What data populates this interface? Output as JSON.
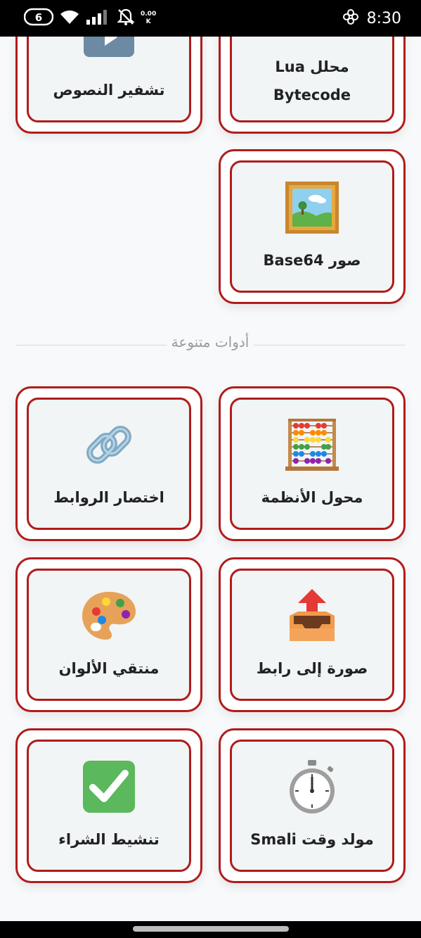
{
  "status_bar": {
    "time": "8:30",
    "net_speed_value": "0.00",
    "net_speed_unit": "K",
    "icons": [
      "nfc-icon",
      "wifi-icon",
      "signal-icon",
      "bell-off-icon",
      "battery-icon",
      "flower-icon"
    ]
  },
  "tools_top": [
    {
      "label": "تشفير النصوص",
      "icon": "video-icon"
    },
    {
      "label": "محلل Lua Bytecode",
      "label_line1": "محلل Lua",
      "label_line2": "Bytecode",
      "icon": "code-icon"
    },
    {
      "label": "صور Base64",
      "icon": "framed-picture-icon"
    }
  ],
  "section": {
    "title": "أدوات متنوعة"
  },
  "tools_misc": [
    {
      "label": "محول الأنظمة",
      "icon": "abacus-icon"
    },
    {
      "label": "اختصار الروابط",
      "icon": "link-icon"
    },
    {
      "label": "صورة إلى رابط",
      "icon": "outbox-tray-icon"
    },
    {
      "label": "منتقي الألوان",
      "icon": "artist-palette-icon"
    },
    {
      "label": "مولد وقت Smali",
      "icon": "stopwatch-icon"
    },
    {
      "label": "تنشيط الشراء",
      "icon": "check-mark-button-icon"
    }
  ],
  "colors": {
    "accent": "#b01c1c",
    "card_inner": "#f1f5f5",
    "background": "#f8f9fa"
  }
}
